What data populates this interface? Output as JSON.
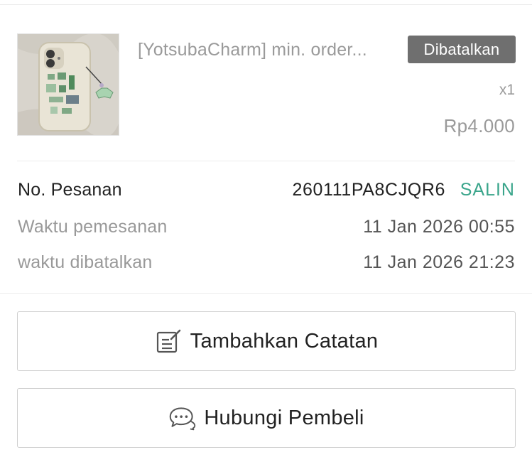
{
  "product": {
    "name": "[YotsubaCharm] min. order...",
    "status": "Dibatalkan",
    "quantity": "x1",
    "price": "Rp4.000",
    "thumbnail_icon": "phone-case-with-clover-charm"
  },
  "order_info": {
    "order_number_label": "No. Pesanan",
    "order_number": "260111PA8CJQR6",
    "copy_label": "SALIN",
    "order_time_label": "Waktu pemesanan",
    "order_time": "11 Jan 2026 00:55",
    "cancel_time_label": "waktu dibatalkan",
    "cancel_time": "11 Jan 2026 21:23"
  },
  "actions": {
    "add_note_label": "Tambahkan Catatan",
    "add_note_icon": "note-edit-icon",
    "contact_buyer_label": "Hubungi Pembeli",
    "contact_buyer_icon": "chat-bubbles-icon"
  },
  "colors": {
    "accent": "#3aa58b",
    "badge_bg": "#6f6f6f",
    "muted_text": "#9a9a9a"
  }
}
